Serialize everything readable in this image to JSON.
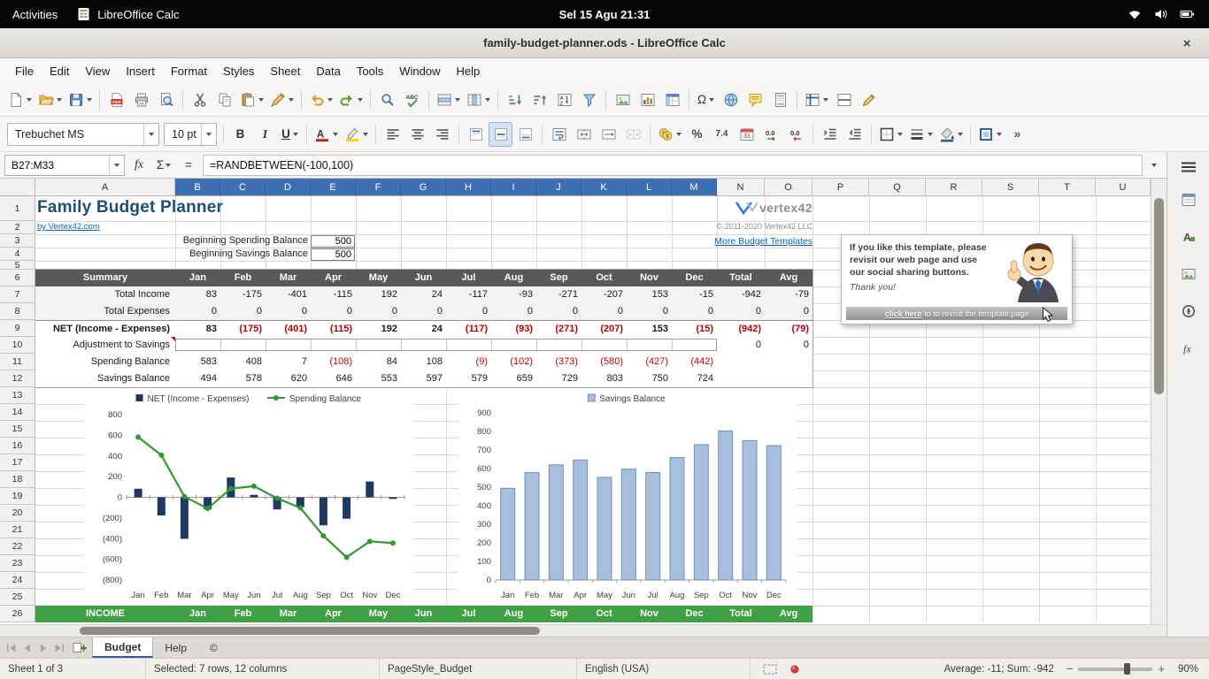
{
  "colors": {
    "title": "#1f4e79",
    "link": "#0563c1",
    "negative": "#c00000",
    "summary_header_bg": "#595959",
    "income_header_bg": "#3fa044",
    "selected_header_bg": "#3d6fb5",
    "net_bar": "#1f3864",
    "spending_line": "#2e9b2e",
    "savings_bar_fill": "#a7bedd",
    "savings_bar_border": "#6d8fc0"
  },
  "gnome_bar": {
    "activities": "Activities",
    "app_name": "LibreOffice Calc",
    "clock": "Sel 15 Agu 21:31",
    "tray_icons": [
      "wifi-icon",
      "volume-icon",
      "battery-icon"
    ]
  },
  "title_bar": {
    "title": "family-budget-planner.ods - LibreOffice Calc",
    "close_glyph": "×"
  },
  "menu_bar": {
    "items": [
      "File",
      "Edit",
      "View",
      "Insert",
      "Format",
      "Styles",
      "Sheet",
      "Data",
      "Tools",
      "Window",
      "Help"
    ]
  },
  "toolbar_main": {
    "buttons": [
      {
        "name": "new-document",
        "dropdown": true
      },
      {
        "name": "open-file",
        "dropdown": true
      },
      {
        "name": "save",
        "dropdown": true
      },
      {
        "sep": true
      },
      {
        "name": "export-as-pdf"
      },
      {
        "name": "print"
      },
      {
        "name": "print-preview"
      },
      {
        "sep": true
      },
      {
        "name": "cut"
      },
      {
        "name": "copy"
      },
      {
        "name": "paste",
        "dropdown": true
      },
      {
        "name": "clone-formatting",
        "dropdown": true
      },
      {
        "sep": true
      },
      {
        "name": "undo",
        "dropdown": true
      },
      {
        "name": "redo",
        "dropdown": true
      },
      {
        "sep": true
      },
      {
        "name": "find-and-replace"
      },
      {
        "name": "spelling"
      },
      {
        "sep": true
      },
      {
        "name": "rows-menu",
        "dropdown": true
      },
      {
        "name": "columns-menu",
        "dropdown": true
      },
      {
        "sep": true
      },
      {
        "name": "sort-ascending"
      },
      {
        "name": "sort-descending"
      },
      {
        "name": "sort"
      },
      {
        "name": "autofilter"
      },
      {
        "sep": true
      },
      {
        "name": "insert-image"
      },
      {
        "name": "insert-chart"
      },
      {
        "name": "insert-pivot-table"
      },
      {
        "sep": true
      },
      {
        "name": "insert-special-character",
        "glyph": "Ω",
        "dropdown": true
      },
      {
        "name": "insert-hyperlink"
      },
      {
        "name": "insert-comment"
      },
      {
        "name": "headers-and-footers"
      },
      {
        "sep": true
      },
      {
        "name": "freeze-rows-and-columns",
        "dropdown": true
      },
      {
        "name": "split-window"
      },
      {
        "name": "show-draw-functions"
      }
    ]
  },
  "toolbar_format": {
    "font_name": "Trebuchet MS",
    "font_size": "10 pt",
    "buttons": [
      {
        "name": "bold",
        "glyph": "B"
      },
      {
        "name": "italic",
        "glyph": "I"
      },
      {
        "name": "underline",
        "glyph": "U",
        "dropdown": true
      },
      {
        "sep": true
      },
      {
        "name": "font-color",
        "glyph": "A",
        "accent": "#c9211e",
        "dropdown": true
      },
      {
        "name": "highlighting-color",
        "accent": "#ffd400",
        "dropdown": true
      },
      {
        "sep": true
      },
      {
        "name": "align-left"
      },
      {
        "name": "align-center"
      },
      {
        "name": "align-right"
      },
      {
        "sep": true
      },
      {
        "name": "align-top"
      },
      {
        "name": "center-vertically",
        "active": true
      },
      {
        "name": "align-bottom"
      },
      {
        "sep": true
      },
      {
        "name": "wrap-text"
      },
      {
        "name": "merge-and-center-cells"
      },
      {
        "name": "merge-cells"
      },
      {
        "name": "unmerge-cells",
        "disabled": true
      },
      {
        "sep": true
      },
      {
        "name": "format-as-currency",
        "dropdown": true
      },
      {
        "name": "format-as-percent",
        "glyph": "%"
      },
      {
        "name": "format-as-number",
        "glyph": "7.4"
      },
      {
        "name": "format-as-date"
      },
      {
        "name": "add-decimal-place",
        "glyph": "0.0"
      },
      {
        "name": "delete-decimal-place",
        "glyph": "0.0"
      },
      {
        "sep": true
      },
      {
        "name": "increase-indent"
      },
      {
        "name": "decrease-indent"
      },
      {
        "sep": true
      },
      {
        "name": "borders",
        "dropdown": true
      },
      {
        "name": "border-style",
        "dropdown": true
      },
      {
        "name": "background-color",
        "accent": "#2a6099",
        "dropdown": true
      },
      {
        "sep": true
      },
      {
        "name": "border-color",
        "dropdown": true
      },
      {
        "name": "toolbar-overflow",
        "glyph": "»"
      }
    ]
  },
  "formula_bar": {
    "name_box": "B27:M33",
    "function_wizard_glyph": "fx",
    "sum_glyph": "Σ",
    "equals_glyph": "=",
    "formula": "=RANDBETWEEN(-100,100)"
  },
  "sheet": {
    "column_letters": [
      "A",
      "B",
      "C",
      "D",
      "E",
      "F",
      "G",
      "H",
      "I",
      "J",
      "K",
      "L",
      "M",
      "N",
      "O",
      "P",
      "Q",
      "R",
      "S",
      "T",
      "U"
    ],
    "selected_columns_from": "B",
    "selected_columns_to": "M",
    "row_numbers": [
      1,
      2,
      3,
      4,
      5,
      6,
      7,
      8,
      9,
      10,
      11,
      12,
      13,
      14,
      15,
      16,
      17,
      18,
      19,
      20,
      21,
      22,
      23,
      24,
      25,
      26
    ],
    "title": "Family Budget Planner",
    "byline": "by Vertex42.com",
    "logo_text": "vertex42",
    "copyright": "© 2011-2020 Vertex42 LLC",
    "more_templates_link": "More Budget Templates",
    "beginning_spending_label": "Beginning Spending Balance",
    "beginning_spending_value": "500",
    "beginning_savings_label": "Beginning Savings Balance",
    "beginning_savings_value": "500",
    "summary": {
      "header": [
        "Summary",
        "Jan",
        "Feb",
        "Mar",
        "Apr",
        "May",
        "Jun",
        "Jul",
        "Aug",
        "Sep",
        "Oct",
        "Nov",
        "Dec",
        "Total",
        "Avg"
      ],
      "rows": [
        {
          "label": "Total Income",
          "style": "plain",
          "values": [
            83,
            -175,
            -401,
            -115,
            192,
            24,
            -117,
            -93,
            -271,
            -207,
            153,
            -15
          ],
          "total": -942,
          "avg": -79
        },
        {
          "label": "Total Expenses",
          "style": "plain",
          "values": [
            0,
            0,
            0,
            0,
            0,
            0,
            0,
            0,
            0,
            0,
            0,
            0
          ],
          "total": 0,
          "avg": 0
        },
        {
          "label": "NET (Income - Expenses)",
          "style": "net",
          "values": [
            83,
            -175,
            -401,
            -115,
            192,
            24,
            -117,
            -93,
            -271,
            -207,
            153,
            -15
          ],
          "total": -942,
          "avg": -79
        },
        {
          "label": "Adjustment to Savings",
          "style": "input",
          "values": [
            "",
            "",
            "",
            "",
            "",
            "",
            "",
            "",
            "",
            "",
            "",
            ""
          ],
          "total": 0,
          "avg": 0,
          "has_comment": true
        },
        {
          "label": "Spending Balance",
          "style": "paren",
          "values": [
            583,
            408,
            7,
            -108,
            84,
            108,
            -9,
            -102,
            -373,
            -580,
            -427,
            -442
          ],
          "total": "",
          "avg": ""
        },
        {
          "label": "Savings Balance",
          "style": "paren",
          "values": [
            494,
            578,
            620,
            646,
            553,
            597,
            579,
            659,
            729,
            803,
            750,
            724
          ],
          "total": "",
          "avg": ""
        }
      ]
    },
    "income_header": [
      "INCOME",
      "Jan",
      "Feb",
      "Mar",
      "Apr",
      "May",
      "Jun",
      "Jul",
      "Aug",
      "Sep",
      "Oct",
      "Nov",
      "Dec",
      "Total",
      "Avg"
    ],
    "ad_box": {
      "lines": [
        "If you like this template, please",
        "revisit our web page and use",
        "our social sharing buttons."
      ],
      "thanks": "Thank you!",
      "button_bold": "click here",
      "button_rest": "to to revisit the template page"
    }
  },
  "chart_data": [
    {
      "type": "combo-bar-line",
      "title": "",
      "categories": [
        "Jan",
        "Feb",
        "Mar",
        "Apr",
        "May",
        "Jun",
        "Jul",
        "Aug",
        "Sep",
        "Oct",
        "Nov",
        "Dec"
      ],
      "series": [
        {
          "name": "NET (Income - Expenses)",
          "kind": "bar",
          "color": "#1f3864",
          "values": [
            83,
            -175,
            -401,
            -115,
            192,
            24,
            -117,
            -93,
            -271,
            -207,
            153,
            -15
          ]
        },
        {
          "name": "Spending Balance",
          "kind": "line",
          "color": "#2e9b2e",
          "values": [
            583,
            408,
            7,
            -108,
            84,
            108,
            -9,
            -102,
            -373,
            -580,
            -427,
            -442
          ]
        }
      ],
      "ylim": [
        -800,
        800
      ],
      "ytick": 200,
      "legend_position": "top",
      "grid": false
    },
    {
      "type": "bar",
      "title": "",
      "categories": [
        "Jan",
        "Feb",
        "Mar",
        "Apr",
        "May",
        "Jun",
        "Jul",
        "Aug",
        "Sep",
        "Oct",
        "Nov",
        "Dec"
      ],
      "series": [
        {
          "name": "Savings Balance",
          "color": "#a7bedd",
          "border_color": "#6d8fc0",
          "values": [
            494,
            578,
            620,
            646,
            553,
            597,
            579,
            659,
            729,
            803,
            750,
            724
          ]
        }
      ],
      "ylim": [
        0,
        900
      ],
      "ytick": 100,
      "legend_position": "top",
      "grid": false
    }
  ],
  "sidebar": {
    "items": [
      "properties",
      "styles",
      "gallery",
      "navigator",
      "functions"
    ]
  },
  "tab_bar": {
    "tabs": [
      "Budget",
      "Help",
      "©"
    ],
    "active_tab": "Budget"
  },
  "status_bar": {
    "sheet_info": "Sheet 1 of 3",
    "selection_info": "Selected: 7 rows, 12 columns",
    "page_style": "PageStyle_Budget",
    "language": "English (USA)",
    "stats": "Average: -11; Sum: -942",
    "zoom_percent": "90%"
  }
}
